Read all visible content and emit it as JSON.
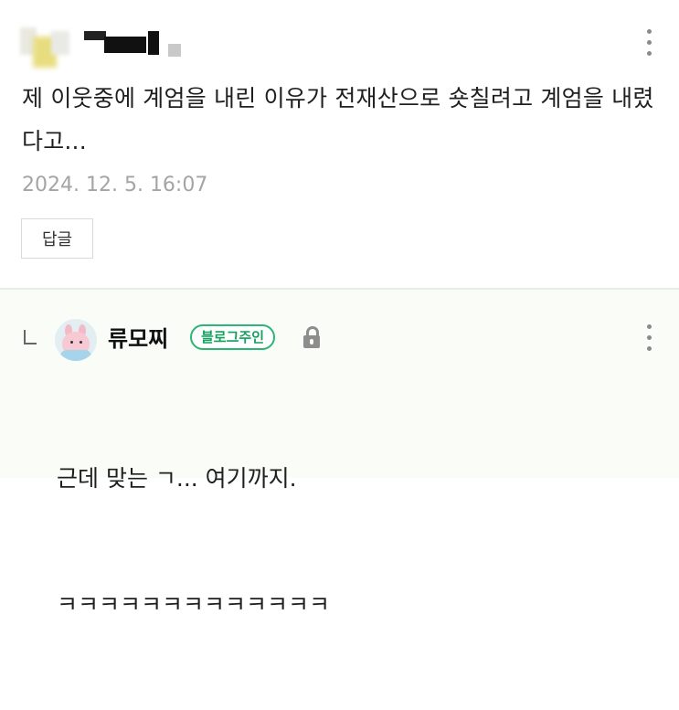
{
  "comment": {
    "text": "제 이웃중에 계엄을 내린 이유가 전재산으로 숏칠려고 계엄을 내렸다고...",
    "timestamp": "2024. 12. 5. 16:07",
    "reply_button_label": "답글",
    "avatar_icon": "blurred-avatar-icon",
    "menu_icon": "more-vertical-icon"
  },
  "reply": {
    "author": "류모찌",
    "badge": "블로그주인",
    "badge_color": "#2bb673",
    "lock_icon": "lock-icon",
    "lines": [
      "근데 맞는 ㄱ... 여기까지.",
      "ㅋㅋㅋㅋㅋㅋㅋㅋㅋㅋㅋㅋㅋ"
    ],
    "menu_icon": "more-vertical-icon"
  }
}
